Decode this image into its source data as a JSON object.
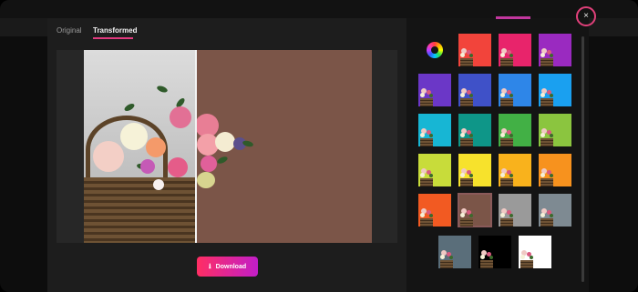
{
  "tabs": [
    {
      "label": "Original",
      "active": false
    },
    {
      "label": "Transformed",
      "active": true
    }
  ],
  "download": {
    "label": "Download",
    "icon": "download-icon"
  },
  "close": {
    "glyph": "×",
    "icon": "close-icon"
  },
  "color_wheel": {
    "icon": "color-wheel-icon"
  },
  "preview": {
    "background_color": "#7B5548"
  },
  "swatches": [
    "#F2443B",
    "#E8246B",
    "#9A2AC0",
    "#6B37C7",
    "#3F51C8",
    "#2E86E8",
    "#1AA0F0",
    "#17B6D4",
    "#0E9688",
    "#42B045",
    "#8BC53F",
    "#C8DC3A",
    "#F7E22C",
    "#F9B21C",
    "#F7921E",
    "#F25A22",
    "#7B5548",
    "#9A9A9A",
    "#7E8A92",
    "#5A6E7A",
    "#000000",
    "#FFFFFF"
  ],
  "selected_swatch": "#7B5548",
  "accent_colors": {
    "tab_underline": "#E03A7E",
    "download_start": "#FF2E63",
    "download_end": "#C21EC8",
    "close_border": "#E0407A"
  }
}
